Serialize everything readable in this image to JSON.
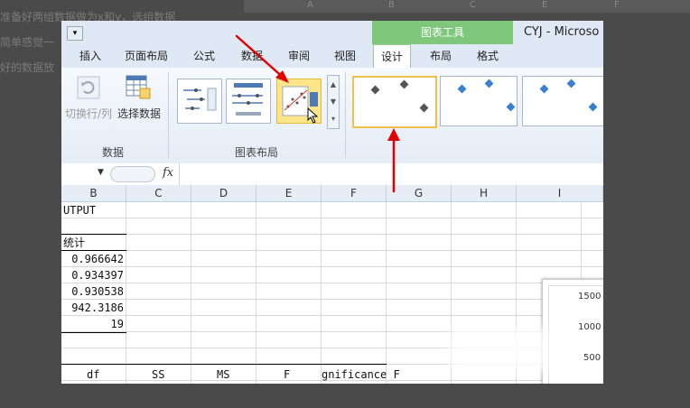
{
  "background": {
    "lines": [
      "准备好两组数据做为x和y，选组数据",
      "简单感觉一",
      "好的数据放"
    ]
  },
  "window": {
    "chart_tools_label": "图表工具",
    "app_title": "CYJ - Microso",
    "tabs": [
      "插入",
      "页面布局",
      "公式",
      "数据",
      "审阅",
      "视图",
      "设计",
      "布局",
      "格式"
    ],
    "active_tab": "设计"
  },
  "ribbon": {
    "data_group": {
      "label": "数据",
      "switch_row_col": "切换行/列",
      "select_data": "选择数据"
    },
    "chart_layout_group": {
      "label": "图表布局"
    }
  },
  "formula_bar": {
    "fx": "fx",
    "value": ""
  },
  "grid": {
    "columns": [
      "B",
      "C",
      "D",
      "E",
      "F",
      "G",
      "H",
      "I"
    ],
    "cells": {
      "b1": "UTPUT",
      "b3": "统计",
      "b4": "0.966642",
      "b5": "0.934397",
      "b6": "0.930538",
      "b7": "942.3186",
      "b8": "19",
      "r11": [
        "df",
        "SS",
        "MS",
        "F",
        "gnificance F"
      ]
    }
  },
  "chart_preview": {
    "y_ticks": [
      "1500",
      "1000",
      "500"
    ]
  },
  "colors": {
    "accent_green": "#7fc77a",
    "selection_gold": "#f2c04a",
    "arrow_red": "#e00000",
    "marker_blue": "#3a7fd0"
  }
}
